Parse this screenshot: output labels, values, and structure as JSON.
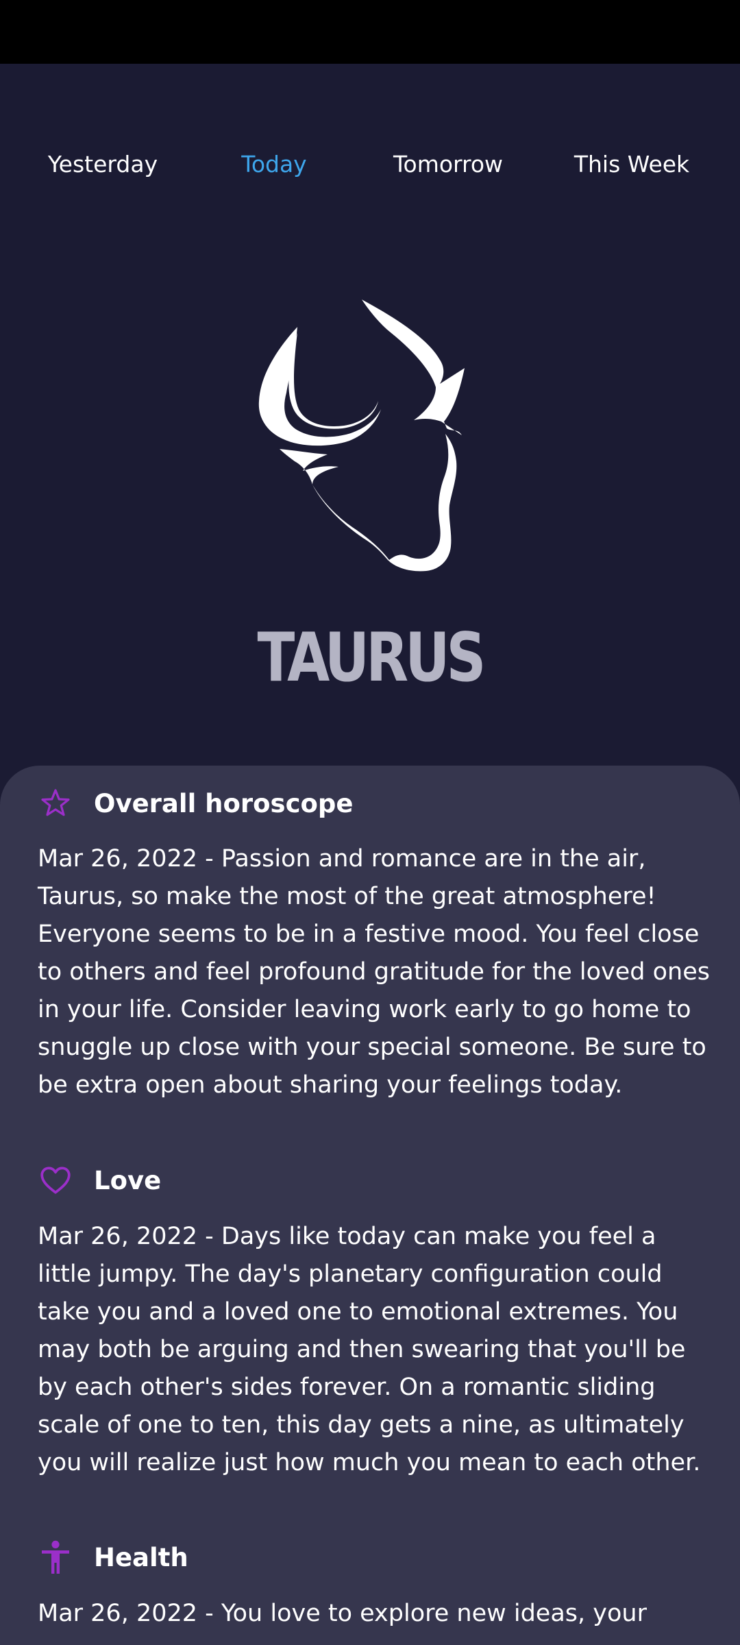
{
  "tabs": [
    {
      "label": "Yesterday",
      "active": false
    },
    {
      "label": "Today",
      "active": true
    },
    {
      "label": "Tomorrow",
      "active": false
    },
    {
      "label": "This Week",
      "active": false
    }
  ],
  "sign": {
    "name": "TAURUS",
    "icon": "taurus-bull-icon"
  },
  "colors": {
    "background": "#1b1b33",
    "card": "#36364e",
    "active_tab": "#3ea6ec",
    "accent_icon": "#9b2fc9",
    "sign_text": "#b4b4c4"
  },
  "sections": [
    {
      "title": "Overall horoscope",
      "icon": "star-icon",
      "text": "Mar 26, 2022 - Passion and romance are in the air, Taurus, so make the most of the great atmosphere! Everyone seems to be in a festive mood. You feel close to others and feel profound gratitude for the loved ones in your life. Consider leaving work early to go home to snuggle up close with your special someone. Be sure to be extra open about sharing your feelings today."
    },
    {
      "title": "Love",
      "icon": "heart-icon",
      "text": "Mar 26, 2022 - Days like today can make you feel a little jumpy. The day's planetary configuration could take you and a loved one to emotional extremes. You may both be arguing and then swearing that you'll be by each other's sides forever. On a romantic sliding scale of one to ten, this day gets a nine, as ultimately you will realize just how much you mean to each other."
    },
    {
      "title": "Health",
      "icon": "person-icon",
      "text": "Mar 26, 2022 - You love to explore new ideas, your"
    }
  ]
}
